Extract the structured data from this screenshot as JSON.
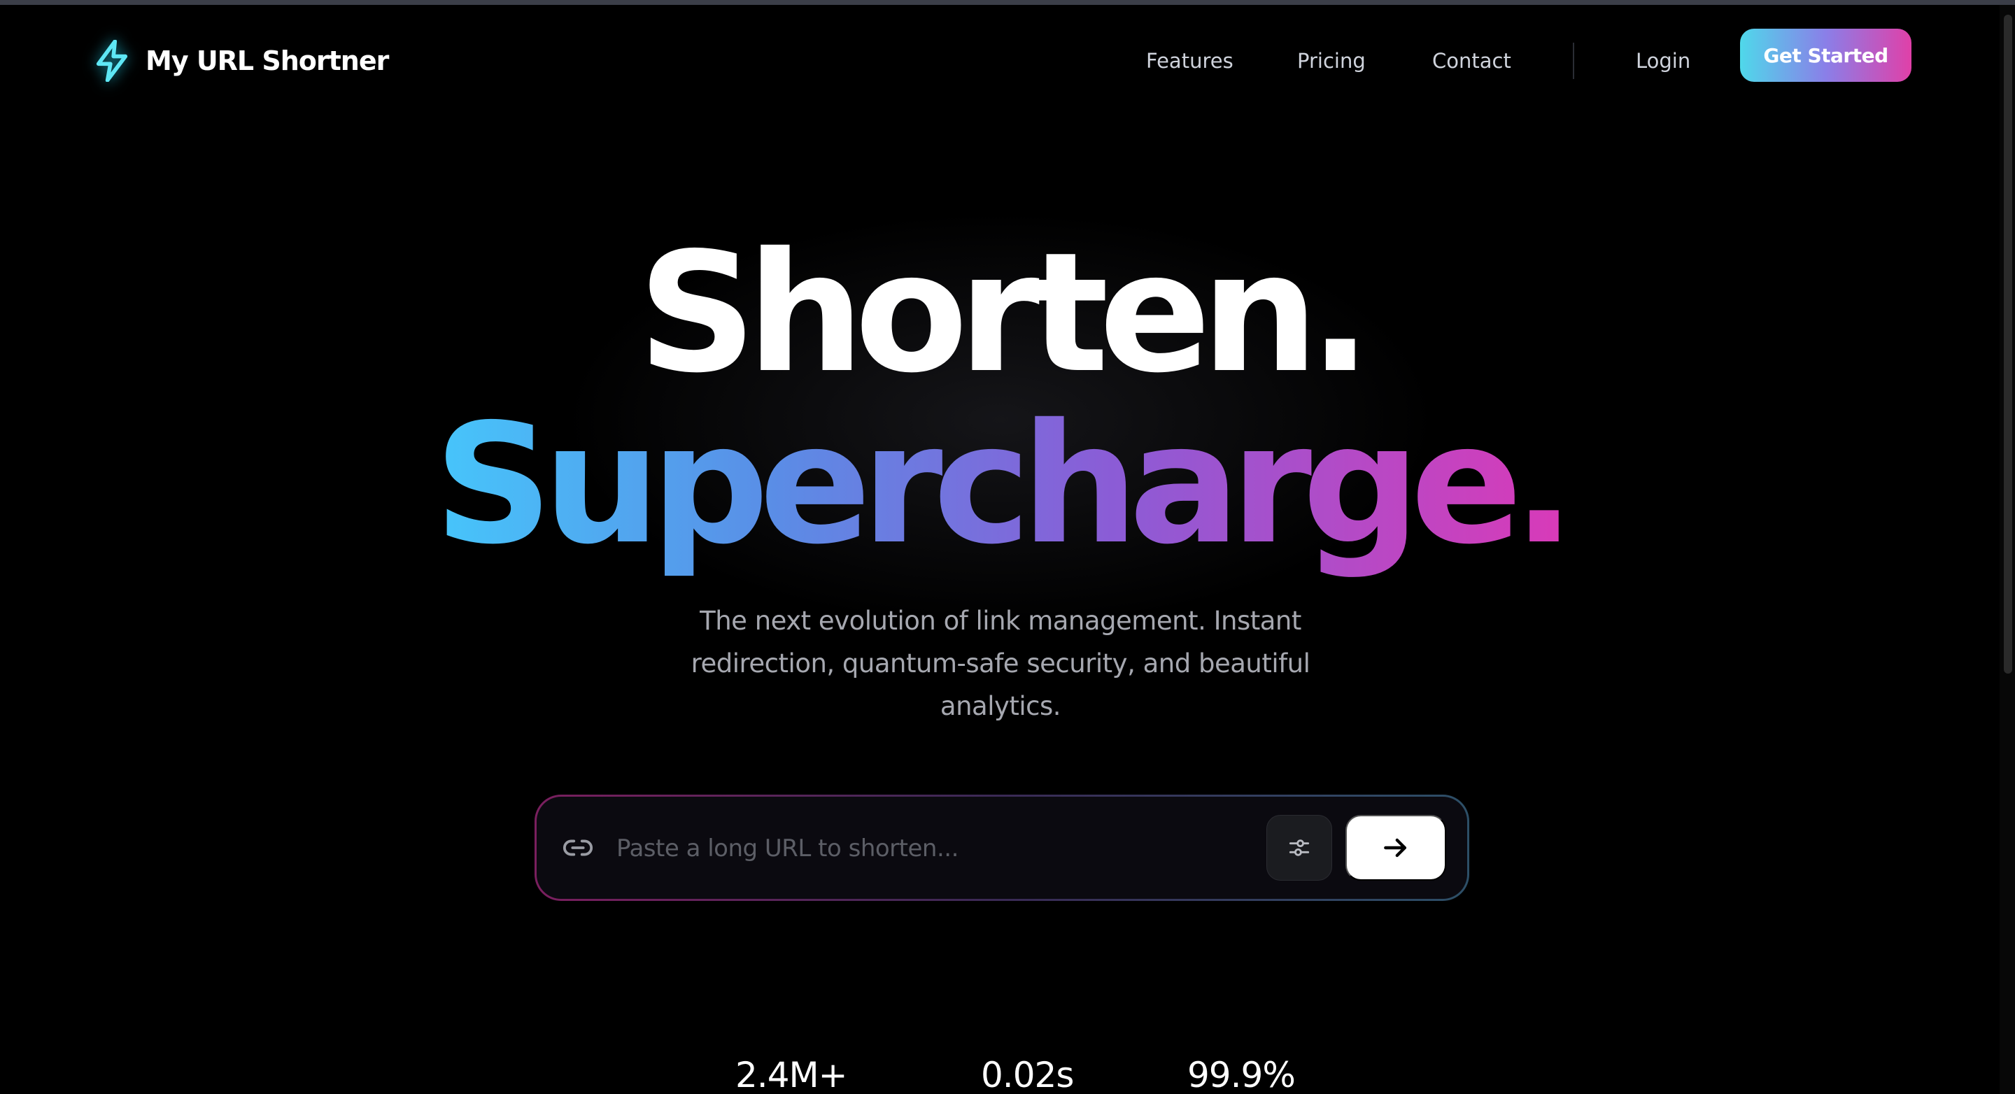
{
  "brand": {
    "name": "My URL Shortner",
    "icon": "bolt-icon",
    "accent": "#22d3ee"
  },
  "nav": {
    "links": [
      {
        "label": "Features"
      },
      {
        "label": "Pricing"
      },
      {
        "label": "Contact"
      }
    ],
    "login_label": "Login",
    "cta_label": "Get Started"
  },
  "hero": {
    "headline_1": "Shorten.",
    "headline_2": "Supercharge.",
    "subtitle": "The next evolution of link management. Instant redirection, quantum-safe security, and beautiful analytics."
  },
  "shortener": {
    "placeholder": "Paste a long URL to shorten...",
    "value": "",
    "link_icon": "link-icon",
    "options_icon": "sliders-icon",
    "submit_icon": "arrow-right-icon"
  },
  "stats": [
    {
      "value": "2.4M+"
    },
    {
      "value": "0.02s"
    },
    {
      "value": "99.9%"
    }
  ],
  "colors": {
    "background": "#000000",
    "gradient_start": "#46c6fb",
    "gradient_mid": "#8b5cd6",
    "gradient_end": "#d93ab8",
    "cta_start": "#4fd8ea",
    "cta_end": "#e040a8"
  }
}
